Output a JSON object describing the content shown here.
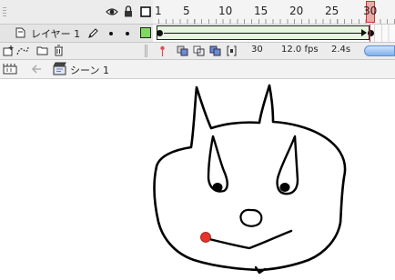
{
  "timeline": {
    "frame_ruler": [
      "1",
      "5",
      "10",
      "15",
      "20",
      "25",
      "30"
    ],
    "current_frame_marker": "30",
    "layer": {
      "name": "レイヤー 1"
    },
    "status": {
      "current_frame": "30",
      "frame_rate": "12.0 fps",
      "elapsed_time": "2.4s"
    }
  },
  "edit_bar": {
    "scene_label": "シーン 1"
  },
  "colors": {
    "playhead": "#e0787a",
    "layer_swatch": "#80d860",
    "tween_fill": "#e6f6e0",
    "stroke": "#000000",
    "nose_dot": "#e8322a"
  },
  "icons": [
    "eye-icon",
    "lock-icon",
    "outline-icon",
    "layer-page-icon",
    "pencil-icon",
    "insert-layer-icon",
    "motion-guide-icon",
    "insert-folder-icon",
    "trash-icon",
    "onion-skin-icon",
    "onion-outline-icon",
    "edit-multiple-icon",
    "onion-markers-icon",
    "timeline-toggle-icon",
    "back-arrow-icon",
    "scene-icon"
  ]
}
